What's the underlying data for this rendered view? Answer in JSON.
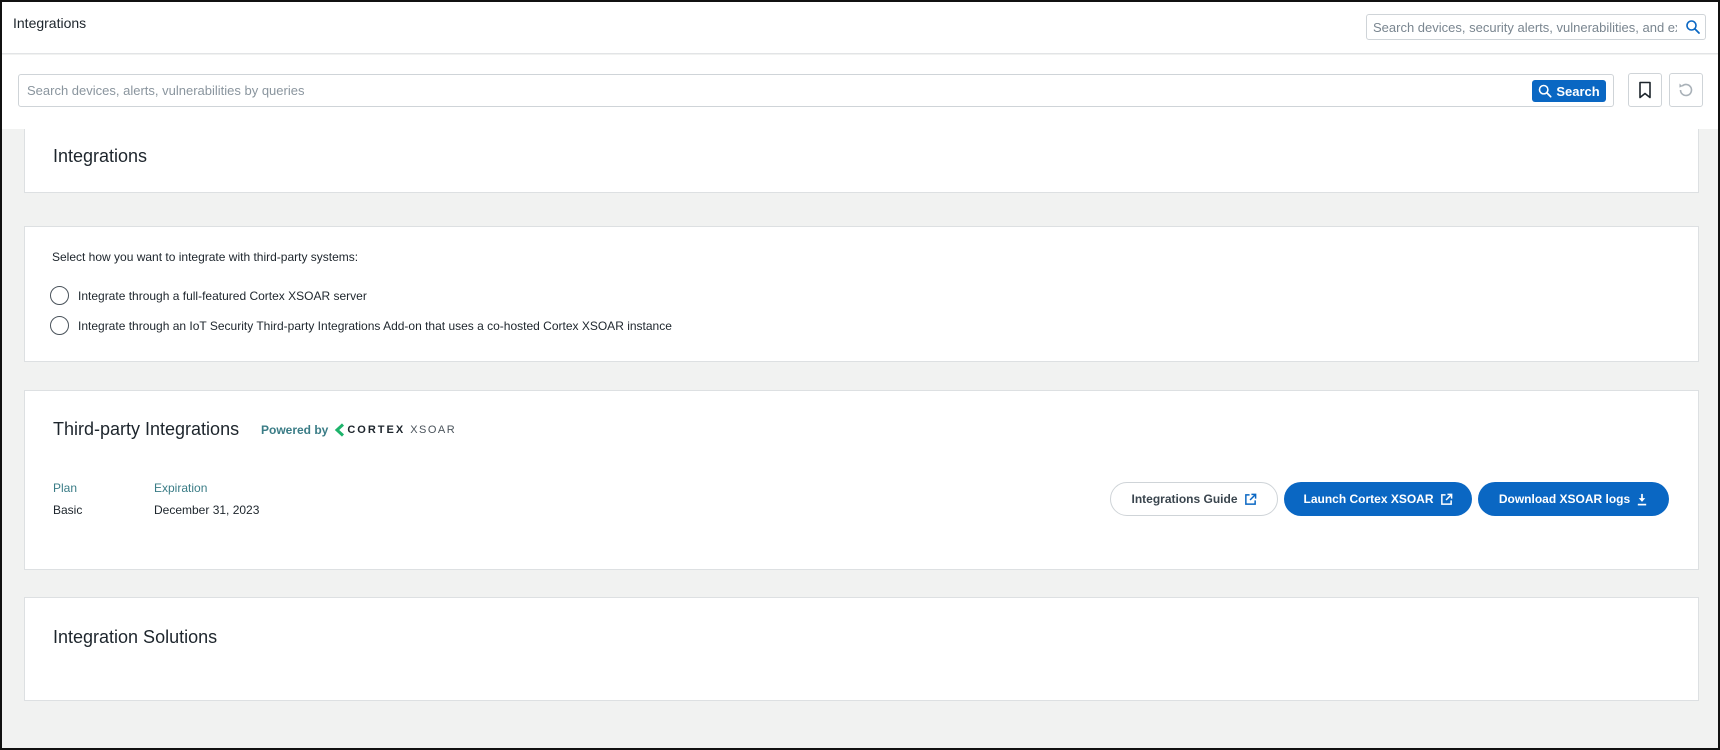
{
  "header": {
    "title": "Integrations",
    "global_search_placeholder": "Search devices, security alerts, vulnerabilities, and exte..."
  },
  "query": {
    "placeholder": "Search devices, alerts, vulnerabilities by queries",
    "search_label": "Search"
  },
  "integrations_card": {
    "title": "Integrations"
  },
  "integration_mode": {
    "prompt": "Select how you want to integrate with third-party systems:",
    "options": [
      {
        "label": "Integrate through a full-featured Cortex XSOAR server",
        "selected": false
      },
      {
        "label": "Integrate through an IoT Security Third-party Integrations Add-on that uses a co-hosted Cortex XSOAR instance",
        "selected": false
      }
    ]
  },
  "third_party": {
    "title": "Third-party Integrations",
    "powered_by": "Powered by",
    "logo_word": "CORTEX",
    "logo_sub": "XSOAR",
    "plan_label": "Plan",
    "plan_value": "Basic",
    "expiration_label": "Expiration",
    "expiration_value": "December 31, 2023",
    "guide_label": "Integrations Guide",
    "launch_label": "Launch Cortex XSOAR",
    "download_label": "Download XSOAR logs"
  },
  "solutions_card": {
    "title": "Integration Solutions"
  },
  "colors": {
    "primary": "#0a67c3",
    "label_teal": "#3a7c86",
    "logo_green": "#1db36b",
    "page_bg": "#f1f2f1"
  }
}
